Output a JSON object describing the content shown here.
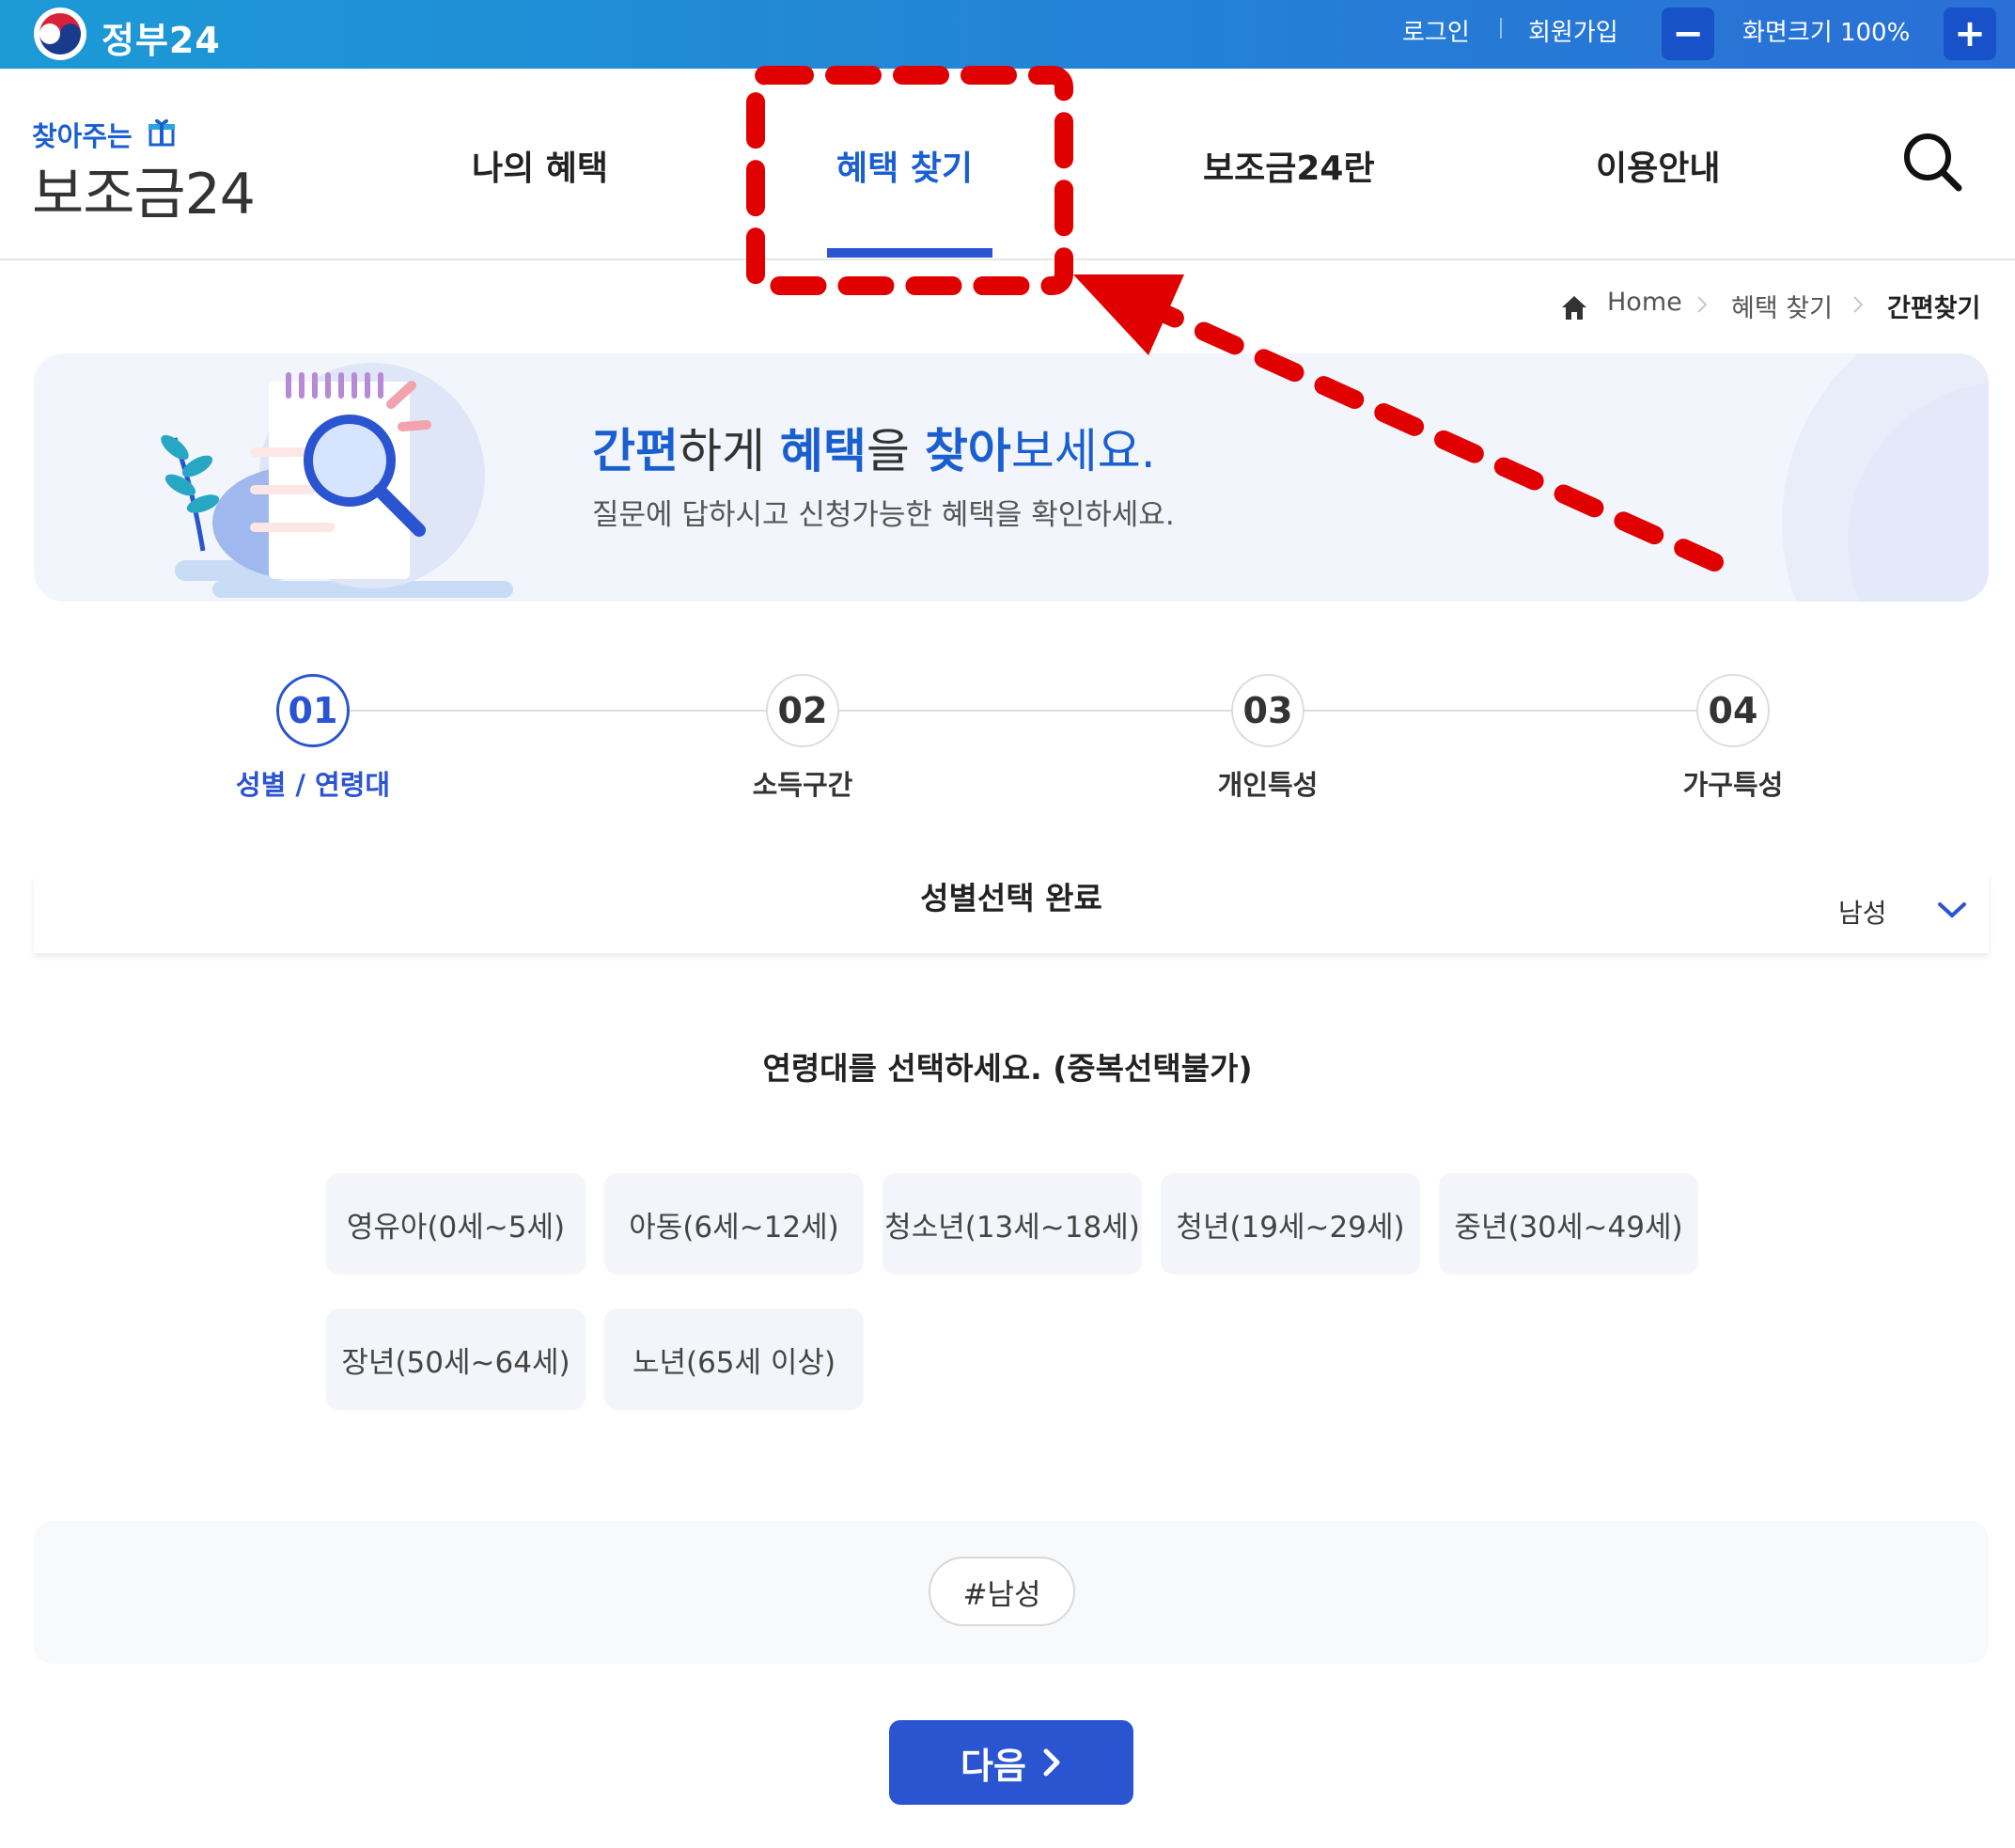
{
  "topbar": {
    "brand": "정부24",
    "login": "로그인",
    "signup": "회원가입",
    "zoom_out": "−",
    "zoom_label": "화면크기 100%",
    "zoom_in": "+"
  },
  "site": {
    "logo_top": "찾아주는",
    "logo_main": "보조금24"
  },
  "nav": {
    "items": [
      "나의 혜택",
      "혜택 찾기",
      "보조금24란",
      "이용안내"
    ],
    "active_index": 1
  },
  "breadcrumb": {
    "home": "Home",
    "section": "혜택 찾기",
    "current": "간편찾기"
  },
  "hero": {
    "title_parts": [
      "간편",
      "하게 ",
      "혜택",
      "을 ",
      "찾아",
      "보세요."
    ],
    "subtitle": "질문에 답하시고 신청가능한 혜택을 확인하세요."
  },
  "steps": [
    {
      "number": "01",
      "label": "성별 / 연령대",
      "active": true
    },
    {
      "number": "02",
      "label": "소득구간",
      "active": false
    },
    {
      "number": "03",
      "label": "개인특성",
      "active": false
    },
    {
      "number": "04",
      "label": "가구특성",
      "active": false
    }
  ],
  "gender_section": {
    "title": "성별선택 완료",
    "selected": "남성"
  },
  "age_section": {
    "question": "연령대를 선택하세요. (중복선택불가)",
    "options": [
      "영유아(0세~5세)",
      "아동(6세~12세)",
      "청소년(13세~18세)",
      "청년(19세~29세)",
      "중년(30세~49세)",
      "장년(50세~64세)",
      "노년(65세 이상)"
    ]
  },
  "tags": [
    "#남성"
  ],
  "next_button": "다음",
  "colors": {
    "primary": "#2a54d0",
    "topbar_start": "#1c9ad6",
    "topbar_end": "#2a6fd6",
    "annotation": "#e00000"
  }
}
